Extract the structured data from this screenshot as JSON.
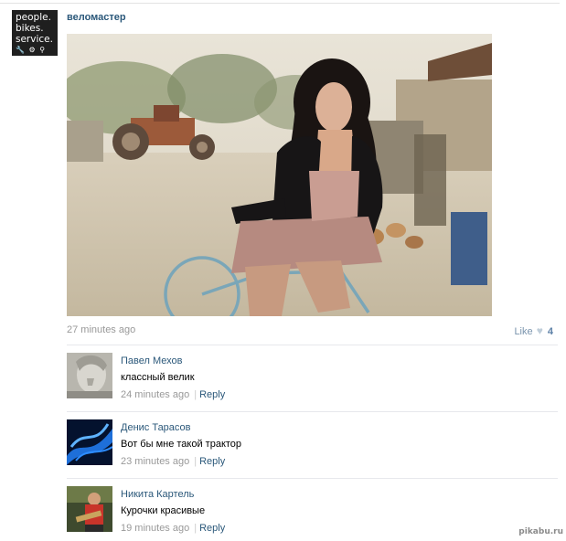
{
  "post": {
    "author": "веломастер",
    "avatar": {
      "lines": [
        "people.",
        "bikes.",
        "service."
      ],
      "icons": "🔧 ⚙ ⚲"
    },
    "time": "27 minutes ago",
    "like_label": "Like",
    "like_count": "4"
  },
  "comments": [
    {
      "name": "Павел Мехов",
      "text": "классный велик",
      "time": "24 minutes ago",
      "reply": "Reply"
    },
    {
      "name": "Денис Тарасов",
      "text": "Вот бы мне такой трактор",
      "time": "23 minutes ago",
      "reply": "Reply"
    },
    {
      "name": "Никита Картель",
      "text": "Курочки красивые",
      "time": "19 minutes ago",
      "reply": "Reply"
    }
  ],
  "watermark": "pikabu.ru",
  "colors": {
    "link": "#2b587a",
    "muted": "#999999",
    "separator": "#e7e8ec"
  }
}
